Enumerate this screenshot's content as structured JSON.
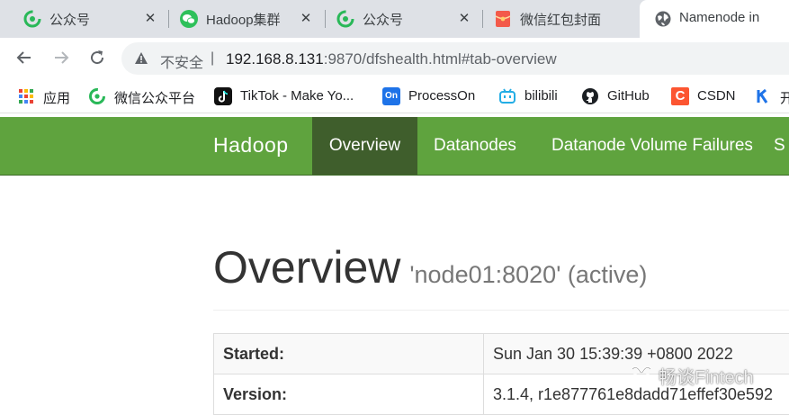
{
  "browser": {
    "tabs": [
      {
        "title": "公众号",
        "icon": "wechat-official-account-icon",
        "active": false
      },
      {
        "title": "Hadoop集群",
        "icon": "wechat-icon",
        "active": false
      },
      {
        "title": "公众号",
        "icon": "wechat-official-account-icon",
        "active": false
      },
      {
        "title": "微信红包封面",
        "icon": "red-envelope-icon",
        "active": false
      },
      {
        "title": "Namenode in",
        "icon": "globe-icon",
        "active": true
      }
    ],
    "close_glyph": "✕",
    "address_bar": {
      "security_label": "不安全",
      "separator": "|",
      "url_host": "192.168.8.131",
      "url_rest": ":9870/dfshealth.html#tab-overview"
    },
    "bookmarks": [
      {
        "label": "应用",
        "icon": "apps-grid-icon"
      },
      {
        "label": "微信公众平台",
        "icon": "wechat-official-account-icon"
      },
      {
        "label": "TikTok - Make Yo...",
        "icon": "tiktok-icon"
      },
      {
        "label": "ProcessOn",
        "icon": "processon-icon",
        "icon_text": "On"
      },
      {
        "label": "bilibili",
        "icon": "bilibili-icon"
      },
      {
        "label": "GitHub",
        "icon": "github-icon"
      },
      {
        "label": "CSDN",
        "icon": "csdn-icon",
        "icon_text": "C"
      },
      {
        "label": "开",
        "icon": "kuaishou-icon"
      }
    ]
  },
  "hadoop": {
    "brand": "Hadoop",
    "nav": [
      {
        "label": "Overview",
        "active": true
      },
      {
        "label": "Datanodes",
        "active": false
      },
      {
        "label": "Datanode Volume Failures",
        "active": false
      },
      {
        "label": "S",
        "active": false
      }
    ],
    "heading": "Overview",
    "subheading": "'node01:8020' (active)",
    "info_rows": [
      {
        "key": "Started:",
        "value": "Sun Jan 30 15:39:39 +0800 2022"
      },
      {
        "key": "Version:",
        "value": "3.1.4, r1e877761e8dadd71effef30e592"
      }
    ]
  },
  "watermark": {
    "text": "畅谈Fintech",
    "icon": "wechat-channel-icon"
  },
  "colors": {
    "navbar_green": "#5fa33e",
    "navbar_active": "#3f5e2c",
    "tabstrip_bg": "#dee1e6"
  }
}
